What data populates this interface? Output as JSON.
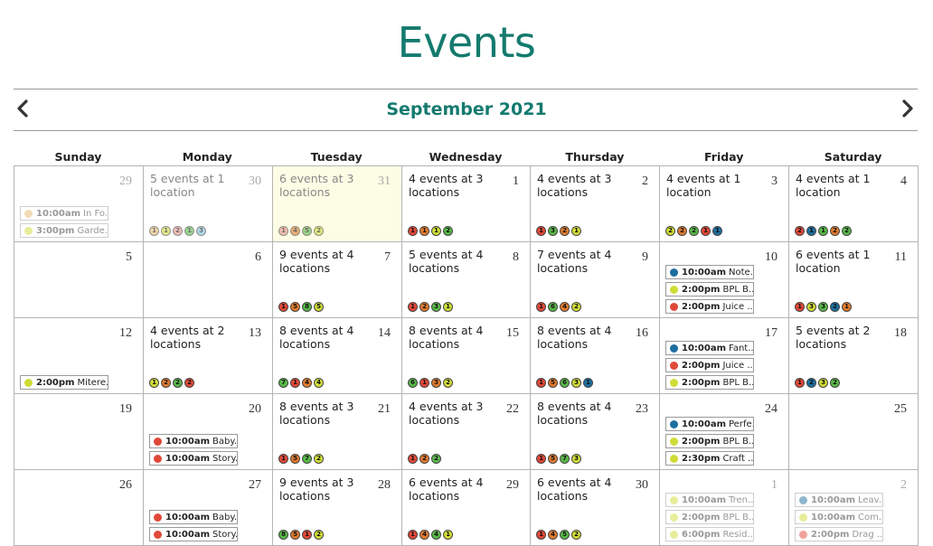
{
  "page": {
    "title": "Events"
  },
  "header": {
    "month": "September 2021"
  },
  "colors": {
    "accent": "#147a6e",
    "red": "#e04838",
    "orange": "#e07a2e",
    "lime": "#cfdc36",
    "green": "#58b848",
    "blue": "#1d6e9e",
    "lightblue": "#7cc0dc",
    "tan": "#e6b86e",
    "pink": "#e8928a"
  },
  "weekdays": [
    "Sunday",
    "Monday",
    "Tuesday",
    "Wednesday",
    "Thursday",
    "Friday",
    "Saturday"
  ],
  "weeks": [
    [
      {
        "day": "29",
        "dim": true,
        "events": [
          {
            "time": "10:00am",
            "title": "In Fo...",
            "color": "#e6b86e"
          },
          {
            "time": "3:00pm",
            "title": "Garde...",
            "color": "#cfdc36"
          }
        ]
      },
      {
        "day": "30",
        "dim": true,
        "summary": "5 events at 1 location",
        "dots": [
          {
            "n": "1",
            "c": "#e6b86e"
          },
          {
            "n": "1",
            "c": "#cfdc36"
          },
          {
            "n": "2",
            "c": "#e8928a"
          },
          {
            "n": "1",
            "c": "#58b848"
          },
          {
            "n": "3",
            "c": "#7cc0dc"
          }
        ]
      },
      {
        "day": "31",
        "dim": true,
        "today": true,
        "summary": "6 events at 3 locations",
        "dots": [
          {
            "n": "1",
            "c": "#e8928a"
          },
          {
            "n": "4",
            "c": "#e07a2e"
          },
          {
            "n": "5",
            "c": "#58b848"
          },
          {
            "n": "2",
            "c": "#cfdc36"
          }
        ]
      },
      {
        "day": "1",
        "summary": "4 events at 3 locations",
        "dots": [
          {
            "n": "1",
            "c": "#e04838"
          },
          {
            "n": "1",
            "c": "#e07a2e"
          },
          {
            "n": "1",
            "c": "#cfdc36"
          },
          {
            "n": "2",
            "c": "#58b848"
          }
        ]
      },
      {
        "day": "2",
        "summary": "4 events at 3 locations",
        "dots": [
          {
            "n": "1",
            "c": "#e04838"
          },
          {
            "n": "3",
            "c": "#58b848"
          },
          {
            "n": "2",
            "c": "#e07a2e"
          },
          {
            "n": "1",
            "c": "#cfdc36"
          }
        ]
      },
      {
        "day": "3",
        "summary": "4 events at 1 location",
        "dots": [
          {
            "n": "2",
            "c": "#cfdc36"
          },
          {
            "n": "2",
            "c": "#e07a2e"
          },
          {
            "n": "2",
            "c": "#58b848"
          },
          {
            "n": "1",
            "c": "#e04838"
          },
          {
            "n": "1",
            "c": "#1d6e9e"
          }
        ]
      },
      {
        "day": "4",
        "summary": "4 events at 1 location",
        "dots": [
          {
            "n": "2",
            "c": "#e04838"
          },
          {
            "n": "1",
            "c": "#1d6e9e"
          },
          {
            "n": "1",
            "c": "#58b848"
          },
          {
            "n": "2",
            "c": "#e07a2e"
          },
          {
            "n": "2",
            "c": "#58b848"
          }
        ]
      }
    ],
    [
      {
        "day": "5"
      },
      {
        "day": "6"
      },
      {
        "day": "7",
        "summary": "9 events at 4 locations",
        "dots": [
          {
            "n": "1",
            "c": "#e04838"
          },
          {
            "n": "5",
            "c": "#e07a2e"
          },
          {
            "n": "8",
            "c": "#58b848"
          },
          {
            "n": "5",
            "c": "#cfdc36"
          }
        ]
      },
      {
        "day": "8",
        "summary": "5 events at 4 locations",
        "dots": [
          {
            "n": "1",
            "c": "#e04838"
          },
          {
            "n": "2",
            "c": "#e07a2e"
          },
          {
            "n": "3",
            "c": "#58b848"
          },
          {
            "n": "1",
            "c": "#cfdc36"
          }
        ]
      },
      {
        "day": "9",
        "summary": "7 events at 4 locations",
        "dots": [
          {
            "n": "1",
            "c": "#e04838"
          },
          {
            "n": "6",
            "c": "#58b848"
          },
          {
            "n": "4",
            "c": "#e07a2e"
          },
          {
            "n": "2",
            "c": "#cfdc36"
          }
        ]
      },
      {
        "day": "10",
        "events": [
          {
            "time": "10:00am",
            "title": "Note...",
            "color": "#1d6e9e"
          },
          {
            "time": "2:00pm",
            "title": "BPL B...",
            "color": "#cfdc36"
          },
          {
            "time": "2:00pm",
            "title": "Juice ...",
            "color": "#e04838"
          }
        ]
      },
      {
        "day": "11",
        "summary": "6 events at 1 location",
        "dots": [
          {
            "n": "1",
            "c": "#e04838"
          },
          {
            "n": "3",
            "c": "#cfdc36"
          },
          {
            "n": "3",
            "c": "#58b848"
          },
          {
            "n": "2",
            "c": "#1d6e9e"
          },
          {
            "n": "1",
            "c": "#e07a2e"
          }
        ]
      }
    ],
    [
      {
        "day": "12",
        "events": [
          {
            "time": "2:00pm",
            "title": "Mitere...",
            "color": "#cfdc36"
          }
        ]
      },
      {
        "day": "13",
        "summary": "4 events at 2 locations",
        "dots": [
          {
            "n": "1",
            "c": "#cfdc36"
          },
          {
            "n": "2",
            "c": "#e07a2e"
          },
          {
            "n": "2",
            "c": "#58b848"
          },
          {
            "n": "2",
            "c": "#e04838"
          }
        ]
      },
      {
        "day": "14",
        "summary": "8 events at 4 locations",
        "dots": [
          {
            "n": "7",
            "c": "#58b848"
          },
          {
            "n": "1",
            "c": "#e04838"
          },
          {
            "n": "4",
            "c": "#e07a2e"
          },
          {
            "n": "4",
            "c": "#cfdc36"
          }
        ]
      },
      {
        "day": "15",
        "summary": "8 events at 4 locations",
        "dots": [
          {
            "n": "6",
            "c": "#58b848"
          },
          {
            "n": "1",
            "c": "#e04838"
          },
          {
            "n": "3",
            "c": "#e07a2e"
          },
          {
            "n": "2",
            "c": "#cfdc36"
          }
        ]
      },
      {
        "day": "16",
        "summary": "8 events at 4 locations",
        "dots": [
          {
            "n": "1",
            "c": "#e04838"
          },
          {
            "n": "5",
            "c": "#e07a2e"
          },
          {
            "n": "6",
            "c": "#58b848"
          },
          {
            "n": "3",
            "c": "#cfdc36"
          },
          {
            "n": "1",
            "c": "#1d6e9e"
          }
        ]
      },
      {
        "day": "17",
        "events": [
          {
            "time": "10:00am",
            "title": "Fant...",
            "color": "#1d6e9e"
          },
          {
            "time": "2:00pm",
            "title": "Juice ...",
            "color": "#e04838"
          },
          {
            "time": "2:00pm",
            "title": "BPL B...",
            "color": "#cfdc36"
          }
        ]
      },
      {
        "day": "18",
        "summary": "5 events at 2 locations",
        "dots": [
          {
            "n": "1",
            "c": "#e04838"
          },
          {
            "n": "2",
            "c": "#1d6e9e"
          },
          {
            "n": "3",
            "c": "#cfdc36"
          },
          {
            "n": "2",
            "c": "#58b848"
          }
        ]
      }
    ],
    [
      {
        "day": "19"
      },
      {
        "day": "20",
        "events": [
          {
            "time": "10:00am",
            "title": "Baby...",
            "color": "#e04838"
          },
          {
            "time": "10:00am",
            "title": "Story...",
            "color": "#e04838"
          }
        ]
      },
      {
        "day": "21",
        "summary": "8 events at 3 locations",
        "dots": [
          {
            "n": "1",
            "c": "#e04838"
          },
          {
            "n": "5",
            "c": "#e07a2e"
          },
          {
            "n": "7",
            "c": "#58b848"
          },
          {
            "n": "2",
            "c": "#cfdc36"
          }
        ]
      },
      {
        "day": "22",
        "summary": "4 events at 3 locations",
        "dots": [
          {
            "n": "1",
            "c": "#e04838"
          },
          {
            "n": "2",
            "c": "#e07a2e"
          },
          {
            "n": "2",
            "c": "#58b848"
          }
        ]
      },
      {
        "day": "23",
        "summary": "8 events at 4 locations",
        "dots": [
          {
            "n": "1",
            "c": "#e04838"
          },
          {
            "n": "5",
            "c": "#e07a2e"
          },
          {
            "n": "7",
            "c": "#58b848"
          },
          {
            "n": "3",
            "c": "#cfdc36"
          }
        ]
      },
      {
        "day": "24",
        "events": [
          {
            "time": "10:00am",
            "title": "Perfe...",
            "color": "#1d6e9e"
          },
          {
            "time": "2:00pm",
            "title": "BPL B...",
            "color": "#cfdc36"
          },
          {
            "time": "2:30pm",
            "title": "Craft ...",
            "color": "#cfdc36"
          }
        ]
      },
      {
        "day": "25"
      }
    ],
    [
      {
        "day": "26"
      },
      {
        "day": "27",
        "events": [
          {
            "time": "10:00am",
            "title": "Baby...",
            "color": "#e04838"
          },
          {
            "time": "10:00am",
            "title": "Story...",
            "color": "#e04838"
          }
        ]
      },
      {
        "day": "28",
        "summary": "9 events at 3 locations",
        "dots": [
          {
            "n": "8",
            "c": "#58b848"
          },
          {
            "n": "5",
            "c": "#e07a2e"
          },
          {
            "n": "1",
            "c": "#e04838"
          },
          {
            "n": "2",
            "c": "#cfdc36"
          }
        ]
      },
      {
        "day": "29",
        "summary": "6 events at 4 locations",
        "dots": [
          {
            "n": "1",
            "c": "#e04838"
          },
          {
            "n": "4",
            "c": "#e07a2e"
          },
          {
            "n": "4",
            "c": "#58b848"
          },
          {
            "n": "1",
            "c": "#cfdc36"
          }
        ]
      },
      {
        "day": "30",
        "summary": "6 events at 4 locations",
        "dots": [
          {
            "n": "1",
            "c": "#e04838"
          },
          {
            "n": "4",
            "c": "#e07a2e"
          },
          {
            "n": "5",
            "c": "#58b848"
          },
          {
            "n": "2",
            "c": "#cfdc36"
          }
        ]
      },
      {
        "day": "1",
        "dim": true,
        "events": [
          {
            "time": "10:00am",
            "title": "Tren...",
            "color": "#cfdc36"
          },
          {
            "time": "2:00pm",
            "title": "BPL B...",
            "color": "#cfdc36"
          },
          {
            "time": "6:00pm",
            "title": "Resid...",
            "color": "#cfdc36"
          }
        ]
      },
      {
        "day": "2",
        "dim": true,
        "events": [
          {
            "time": "10:00am",
            "title": "Leav...",
            "color": "#1d6e9e"
          },
          {
            "time": "10:00am",
            "title": "Com...",
            "color": "#cfdc36"
          },
          {
            "time": "2:00pm",
            "title": "Drag ...",
            "color": "#e04838"
          }
        ]
      }
    ]
  ]
}
